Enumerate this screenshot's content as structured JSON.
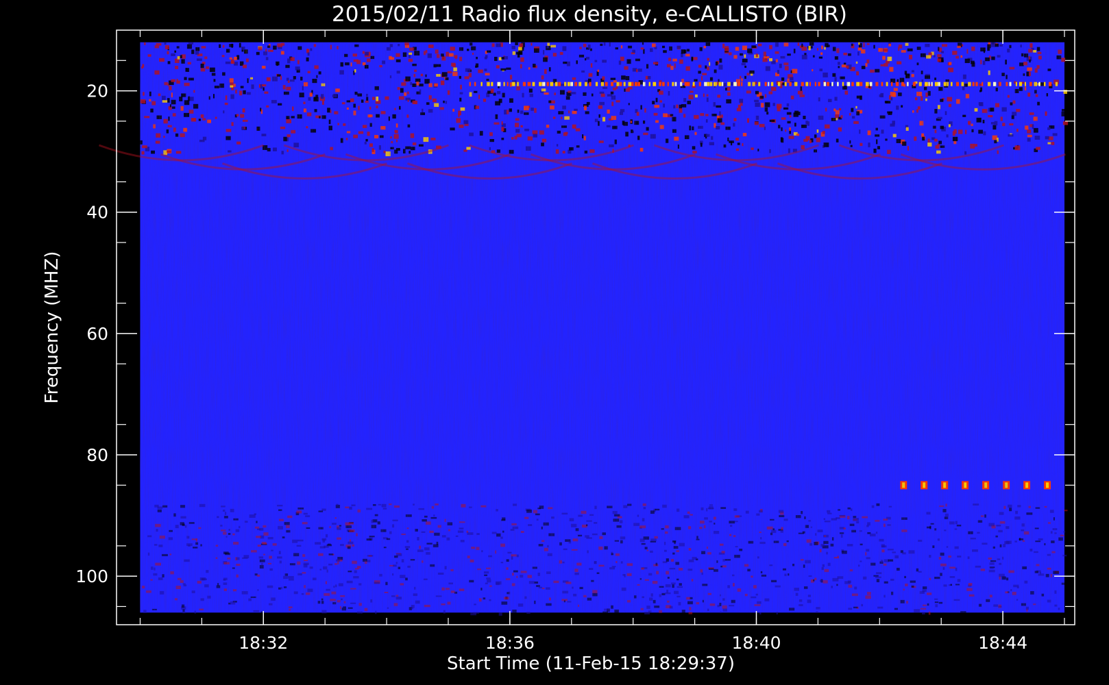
{
  "chart_data": {
    "type": "heatmap",
    "title": "2015/02/11  Radio flux density, e-CALLISTO (BIR)",
    "xlabel": "Start Time (11-Feb-15 18:29:37)",
    "ylabel": "Frequency (MHZ)",
    "x_unit": "UT time",
    "y_unit": "MHz",
    "ylim": [
      108,
      10
    ],
    "xlim": [
      "18:29:37",
      "18:45:10"
    ],
    "data_xlim": [
      "18:30:00",
      "18:45:00"
    ],
    "data_ylim": [
      106,
      12
    ],
    "x_ticks": [
      "18:32",
      "18:36",
      "18:40",
      "18:44"
    ],
    "y_ticks": [
      20,
      40,
      60,
      80,
      100
    ],
    "colormap": [
      "#000000",
      "#1b0f9a",
      "#2323ff",
      "#b4121e",
      "#ff3a00",
      "#ffd000",
      "#ffffcc"
    ],
    "background_color": "#2323ff",
    "features": [
      {
        "label": "strong RFI bands",
        "y_range": [
          12,
          30
        ]
      },
      {
        "label": "persistent line",
        "y": 19
      },
      {
        "label": "interference bands",
        "y_range": [
          88,
          106
        ]
      },
      {
        "label": "pulses",
        "y": 85,
        "x_range": [
          "18:42:20",
          "18:45:00"
        ]
      }
    ]
  }
}
